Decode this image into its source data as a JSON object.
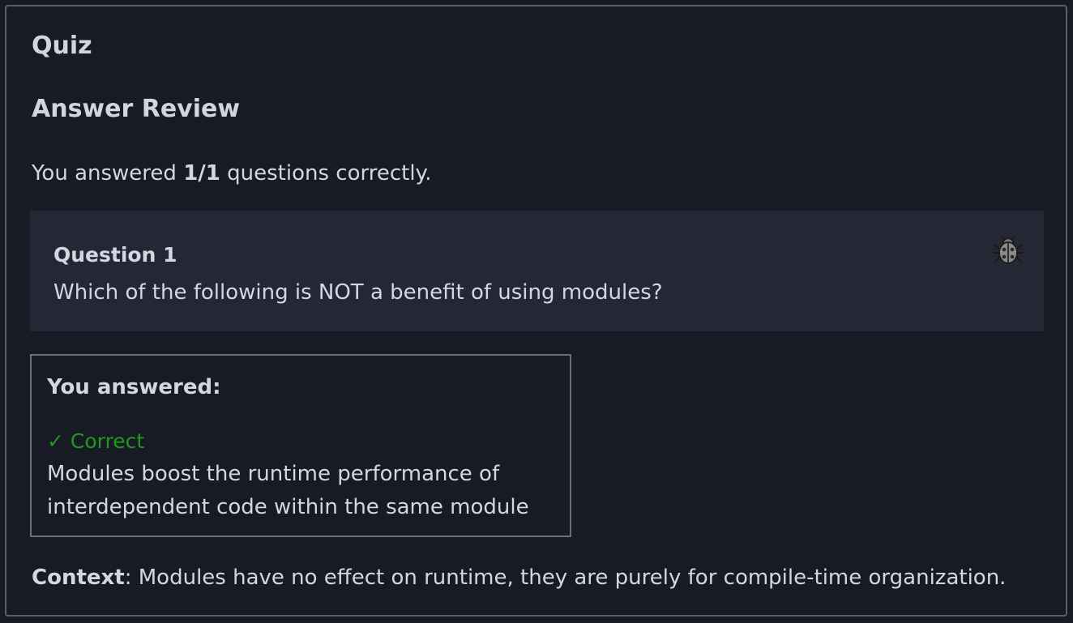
{
  "page": {
    "title": "Quiz",
    "heading": "Answer Review"
  },
  "score": {
    "prefix": "You answered ",
    "value": "1/1",
    "suffix": " questions correctly."
  },
  "question": {
    "label": "Question 1",
    "text": "Which of the following is NOT a benefit of using modules?",
    "report_icon": "bug-icon"
  },
  "answer": {
    "label": "You answered:",
    "status": "✓ Correct",
    "status_color": "#1f9a1f",
    "text": "Modules boost the runtime performance of interdependent code within the same module"
  },
  "context": {
    "label": "Context",
    "text": ": Modules have no effect on runtime, they are purely for compile-time organization."
  }
}
